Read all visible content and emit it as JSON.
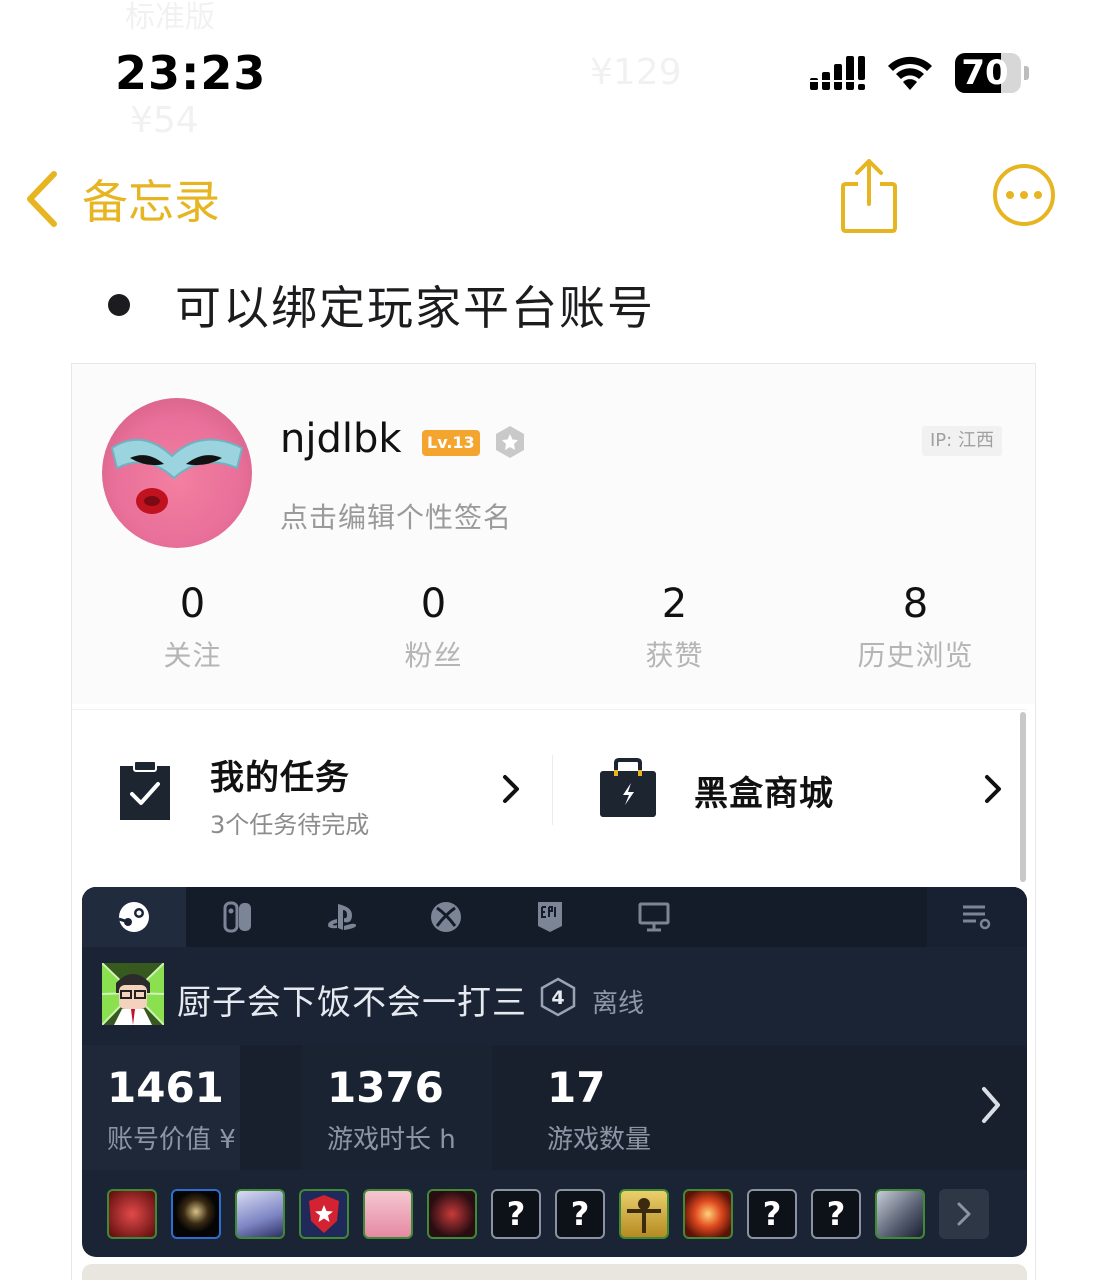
{
  "status_bar": {
    "time": "23:23",
    "battery": "70",
    "battery_level_percent": 70
  },
  "nav": {
    "back_label": "备忘录",
    "accent_color": "#e6b521"
  },
  "note": {
    "bullet_text": "可以绑定玩家平台账号"
  },
  "profile": {
    "username": "njdlbk",
    "level_badge": "Lv.13",
    "ip_label": "IP: 江西",
    "signature_placeholder": "点击编辑个性签名",
    "stats": [
      {
        "value": "0",
        "label": "关注"
      },
      {
        "value": "0",
        "label": "粉丝"
      },
      {
        "value": "2",
        "label": "获赞"
      },
      {
        "value": "8",
        "label": "历史浏览"
      }
    ]
  },
  "tasks": {
    "my_tasks_title": "我的任务",
    "my_tasks_sub": "3个任务待完成",
    "shop_title": "黑盒商城"
  },
  "game_panel": {
    "tabs": [
      {
        "icon": "steam-icon",
        "active": true
      },
      {
        "icon": "switch-icon",
        "active": false
      },
      {
        "icon": "playstation-icon",
        "active": false
      },
      {
        "icon": "xbox-icon",
        "active": false
      },
      {
        "icon": "epic-games-icon",
        "active": false
      },
      {
        "icon": "pc-monitor-icon",
        "active": false
      }
    ],
    "account_name": "厨子会下饭不会一打三",
    "account_level": "4",
    "account_status": "离线",
    "metrics": [
      {
        "value": "1461",
        "label": "账号价值 ¥"
      },
      {
        "value": "1376",
        "label": "游戏时长 h"
      },
      {
        "value": "17",
        "label": "游戏数量"
      }
    ],
    "unknown_game_glyph": "?",
    "bg_color": "#1b2434"
  }
}
